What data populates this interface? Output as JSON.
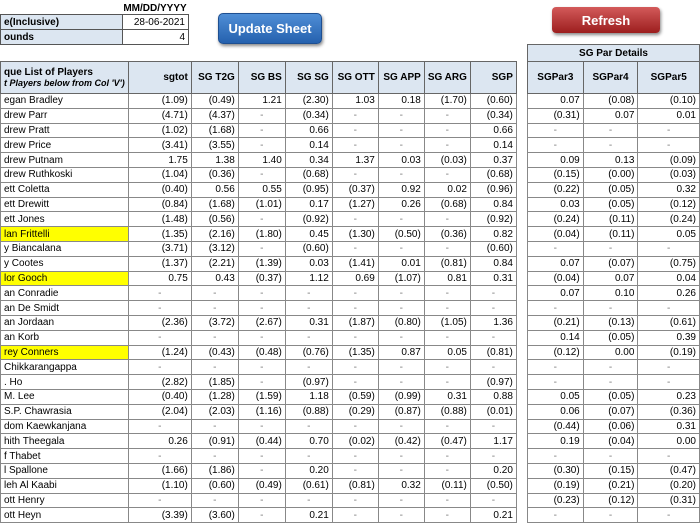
{
  "header": {
    "date_format": "MM/DD/YYYY",
    "date_label": "e(Inclusive)",
    "date_value": "28-06-2021",
    "rounds_label": "ounds",
    "rounds_value": "4"
  },
  "buttons": {
    "update": "Update Sheet",
    "refresh": "Refresh"
  },
  "colors": {
    "highlight": "#ffff00",
    "header_bg": "#dce6f1",
    "update_btn": "#2f6fbf",
    "refresh_btn": "#b83232"
  },
  "main_table": {
    "name_header": "que List of Players",
    "name_subheader": "t Players below from Col 'V')",
    "columns": [
      "sgtot",
      "SG T2G",
      "SG BS",
      "SG SG",
      "SG OTT",
      "SG APP",
      "SG ARG",
      "SGP"
    ],
    "rows": [
      {
        "name": "egan Bradley",
        "v": [
          "(1.09)",
          "(0.49)",
          "1.21",
          "(2.30)",
          "1.03",
          "0.18",
          "(1.70)",
          "(0.60)"
        ]
      },
      {
        "name": "drew Parr",
        "v": [
          "(4.71)",
          "(4.37)",
          "-",
          "(0.34)",
          "-",
          "-",
          "-",
          "(0.34)"
        ]
      },
      {
        "name": "drew Pratt",
        "v": [
          "(1.02)",
          "(1.68)",
          "-",
          "0.66",
          "-",
          "-",
          "-",
          "0.66"
        ]
      },
      {
        "name": "drew Price",
        "v": [
          "(3.41)",
          "(3.55)",
          "-",
          "0.14",
          "-",
          "-",
          "-",
          "0.14"
        ]
      },
      {
        "name": "drew Putnam",
        "v": [
          "1.75",
          "1.38",
          "1.40",
          "0.34",
          "1.37",
          "0.03",
          "(0.03)",
          "0.37"
        ]
      },
      {
        "name": "drew Ruthkoski",
        "v": [
          "(1.04)",
          "(0.36)",
          "-",
          "(0.68)",
          "-",
          "-",
          "-",
          "(0.68)"
        ]
      },
      {
        "name": "ett Coletta",
        "v": [
          "(0.40)",
          "0.56",
          "0.55",
          "(0.95)",
          "(0.37)",
          "0.92",
          "0.02",
          "(0.96)"
        ]
      },
      {
        "name": "ett Drewitt",
        "v": [
          "(0.84)",
          "(1.68)",
          "(1.01)",
          "0.17",
          "(1.27)",
          "0.26",
          "(0.68)",
          "0.84"
        ]
      },
      {
        "name": "ett Jones",
        "v": [
          "(1.48)",
          "(0.56)",
          "-",
          "(0.92)",
          "-",
          "-",
          "-",
          "(0.92)"
        ]
      },
      {
        "name": "lan Frittelli",
        "hl": true,
        "v": [
          "(1.35)",
          "(2.16)",
          "(1.80)",
          "0.45",
          "(1.30)",
          "(0.50)",
          "(0.36)",
          "0.82"
        ]
      },
      {
        "name": "y Biancalana",
        "v": [
          "(3.71)",
          "(3.12)",
          "-",
          "(0.60)",
          "-",
          "-",
          "-",
          "(0.60)"
        ]
      },
      {
        "name": "y Cootes",
        "v": [
          "(1.37)",
          "(2.21)",
          "(1.39)",
          "0.03",
          "(1.41)",
          "0.01",
          "(0.81)",
          "0.84"
        ]
      },
      {
        "name": "lor Gooch",
        "hl": true,
        "v": [
          "0.75",
          "0.43",
          "(0.37)",
          "1.12",
          "0.69",
          "(1.07)",
          "0.81",
          "0.31"
        ]
      },
      {
        "name": "an Conradie",
        "v": [
          "-",
          "-",
          "-",
          "-",
          "-",
          "-",
          "-",
          "-"
        ]
      },
      {
        "name": "an De Smidt",
        "v": [
          "-",
          "-",
          "-",
          "-",
          "-",
          "-",
          "-",
          "-"
        ]
      },
      {
        "name": "an Jordaan",
        "v": [
          "(2.36)",
          "(3.72)",
          "(2.67)",
          "0.31",
          "(1.87)",
          "(0.80)",
          "(1.05)",
          "1.36"
        ]
      },
      {
        "name": "an Korb",
        "v": [
          "-",
          "-",
          "-",
          "-",
          "-",
          "-",
          "-",
          "-"
        ]
      },
      {
        "name": "rey Conners",
        "hl": true,
        "v": [
          "(1.24)",
          "(0.43)",
          "(0.48)",
          "(0.76)",
          "(1.35)",
          "0.87",
          "0.05",
          "(0.81)"
        ]
      },
      {
        "name": "Chikkarangappa",
        "v": [
          "-",
          "-",
          "-",
          "-",
          "-",
          "-",
          "-",
          "-"
        ]
      },
      {
        "name": ". Ho",
        "v": [
          "(2.82)",
          "(1.85)",
          "-",
          "(0.97)",
          "-",
          "-",
          "-",
          "(0.97)"
        ]
      },
      {
        "name": "M. Lee",
        "v": [
          "(0.40)",
          "(1.28)",
          "(1.59)",
          "1.18",
          "(0.59)",
          "(0.99)",
          "0.31",
          "0.88"
        ]
      },
      {
        "name": "S.P. Chawrasia",
        "v": [
          "(2.04)",
          "(2.03)",
          "(1.16)",
          "(0.88)",
          "(0.29)",
          "(0.87)",
          "(0.88)",
          "(0.01)"
        ]
      },
      {
        "name": "dom Kaewkanjana",
        "v": [
          "-",
          "-",
          "-",
          "-",
          "-",
          "-",
          "-",
          "-"
        ]
      },
      {
        "name": "hith Theegala",
        "v": [
          "0.26",
          "(0.91)",
          "(0.44)",
          "0.70",
          "(0.02)",
          "(0.42)",
          "(0.47)",
          "1.17"
        ]
      },
      {
        "name": "f Thabet",
        "v": [
          "-",
          "-",
          "-",
          "-",
          "-",
          "-",
          "-",
          "-"
        ]
      },
      {
        "name": "l Spallone",
        "v": [
          "(1.66)",
          "(1.86)",
          "-",
          "0.20",
          "-",
          "-",
          "-",
          "0.20"
        ]
      },
      {
        "name": "leh Al Kaabi",
        "v": [
          "(1.10)",
          "(0.60)",
          "(0.49)",
          "(0.61)",
          "(0.81)",
          "0.32",
          "(0.11)",
          "(0.50)"
        ]
      },
      {
        "name": "ott Henry",
        "v": [
          "-",
          "-",
          "-",
          "-",
          "-",
          "-",
          "-",
          "-"
        ]
      },
      {
        "name": "ott Heyn",
        "v": [
          "(3.39)",
          "(3.60)",
          "-",
          "0.21",
          "-",
          "-",
          "-",
          "0.21"
        ]
      }
    ]
  },
  "par_table": {
    "title": "SG Par Details",
    "columns": [
      "SGPar3",
      "SGPar4",
      "SGPar5"
    ],
    "rows": [
      [
        "0.07",
        "(0.08)",
        "(0.10)"
      ],
      [
        "(0.31)",
        "0.07",
        "0.01"
      ],
      [
        "-",
        "-",
        "-"
      ],
      [
        "-",
        "-",
        "-"
      ],
      [
        "0.09",
        "0.13",
        "(0.09)"
      ],
      [
        "(0.15)",
        "(0.00)",
        "(0.03)"
      ],
      [
        "(0.22)",
        "(0.05)",
        "0.32"
      ],
      [
        "0.03",
        "(0.05)",
        "(0.12)"
      ],
      [
        "(0.24)",
        "(0.11)",
        "(0.24)"
      ],
      [
        "(0.04)",
        "(0.11)",
        "0.05"
      ],
      [
        "-",
        "-",
        "-"
      ],
      [
        "0.07",
        "(0.07)",
        "(0.75)"
      ],
      [
        "(0.04)",
        "0.07",
        "0.04"
      ],
      [
        "0.07",
        "0.10",
        "0.26"
      ],
      [
        "-",
        "-",
        "-"
      ],
      [
        "(0.21)",
        "(0.13)",
        "(0.61)"
      ],
      [
        "0.14",
        "(0.05)",
        "0.39"
      ],
      [
        "(0.12)",
        "0.00",
        "(0.19)"
      ],
      [
        "-",
        "-",
        "-"
      ],
      [
        "-",
        "-",
        "-"
      ],
      [
        "0.05",
        "(0.05)",
        "0.23"
      ],
      [
        "0.06",
        "(0.07)",
        "(0.36)"
      ],
      [
        "(0.44)",
        "(0.06)",
        "0.31"
      ],
      [
        "0.19",
        "(0.04)",
        "0.00"
      ],
      [
        "-",
        "-",
        "-"
      ],
      [
        "(0.30)",
        "(0.15)",
        "(0.47)"
      ],
      [
        "(0.19)",
        "(0.21)",
        "(0.20)"
      ],
      [
        "(0.23)",
        "(0.12)",
        "(0.31)"
      ],
      [
        "-",
        "-",
        "-"
      ]
    ]
  }
}
